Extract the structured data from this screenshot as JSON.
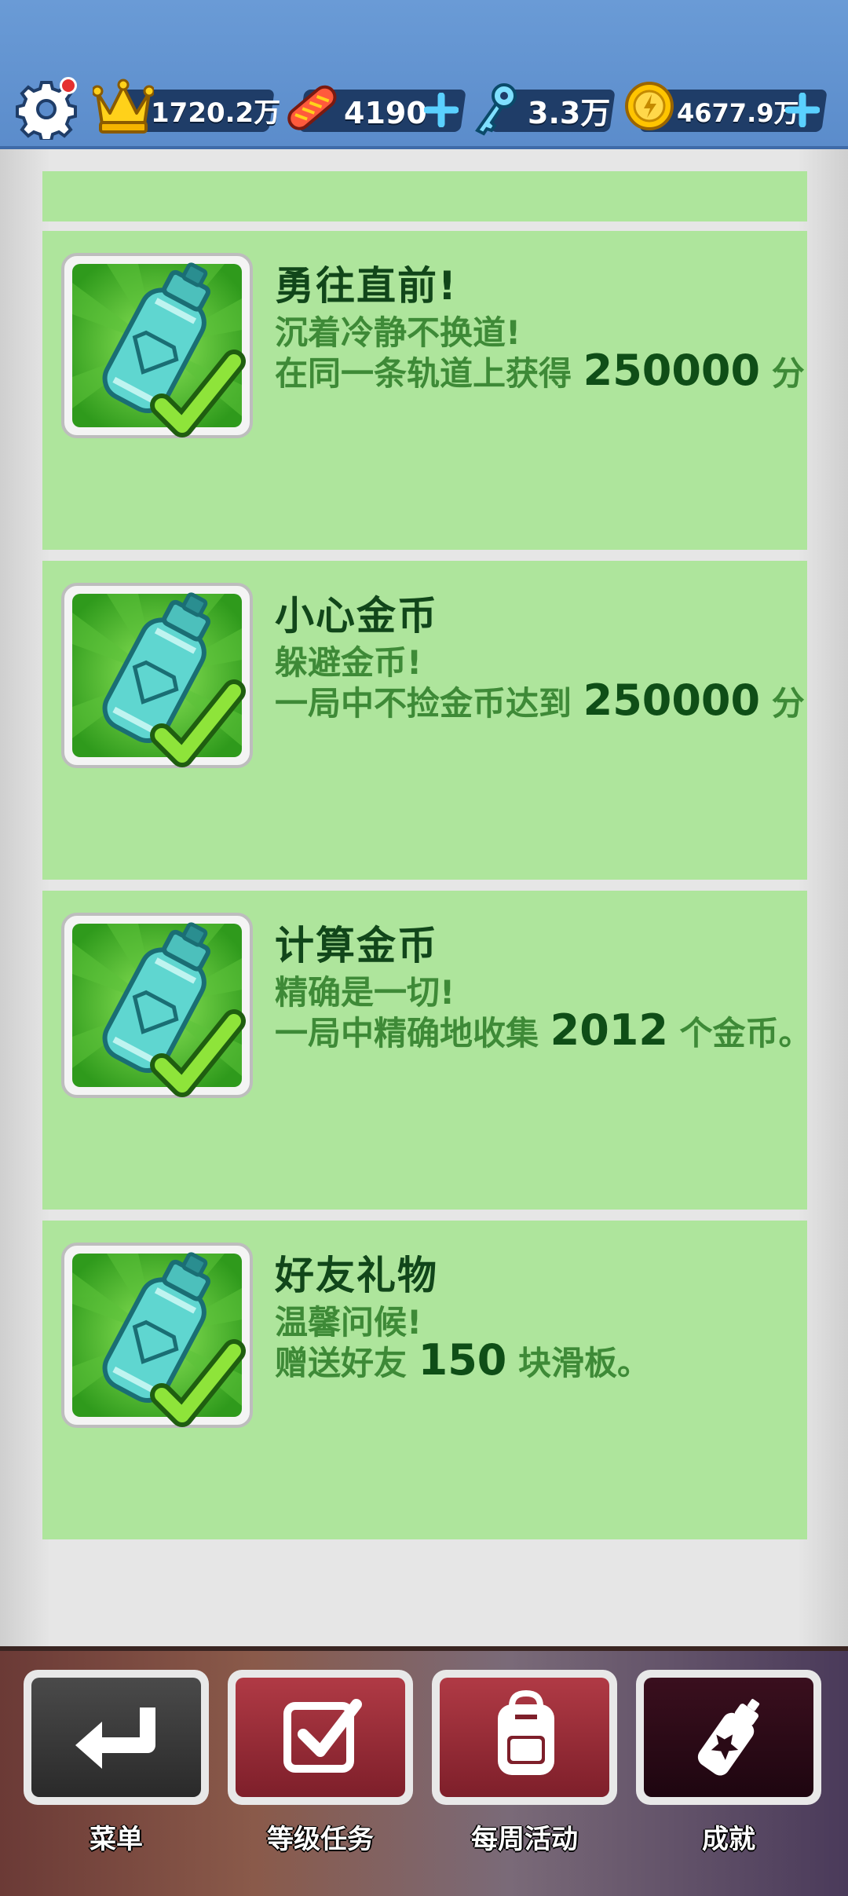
{
  "currencies": {
    "crowns": "1720.2万",
    "boards": "4190",
    "keys": "3.3万",
    "coins": "4677.9万"
  },
  "achievements": [
    {
      "title": "勇往直前!",
      "subtitle": "沉着冷静不换道!",
      "desc_prefix": "在同一条轨道上获得 ",
      "desc_number": "250000",
      "desc_suffix": " 分"
    },
    {
      "title": "小心金币",
      "subtitle": "躲避金币!",
      "desc_prefix": " 一局中不捡金币达到 ",
      "desc_number": "250000",
      "desc_suffix": " 分"
    },
    {
      "title": "计算金币",
      "subtitle": "精确是一切!",
      "desc_prefix": "一局中精确地收集 ",
      "desc_number": "2012",
      "desc_suffix": " 个金币。"
    },
    {
      "title": "好友礼物",
      "subtitle": "温馨问候!",
      "desc_prefix": "赠送好友 ",
      "desc_number": "150",
      "desc_suffix": " 块滑板。"
    }
  ],
  "nav": {
    "menu": "菜单",
    "level_tasks": "等级任务",
    "weekly": "每周活动",
    "achievements": "成就"
  },
  "colors": {
    "card_bg": "#aee59c",
    "title": "#11461a",
    "text": "#3e8a37",
    "top_bar": "#5b8ccb",
    "active_tab": "#2a0a16",
    "tab_red": "#8e2a35"
  },
  "icons": [
    "gear-icon",
    "crown-icon",
    "skateboard-icon",
    "key-icon",
    "coin-icon",
    "plus-icon",
    "spray-can-icon",
    "checkmark-icon",
    "return-arrow-icon",
    "checkbox-icon",
    "backpack-icon"
  ]
}
